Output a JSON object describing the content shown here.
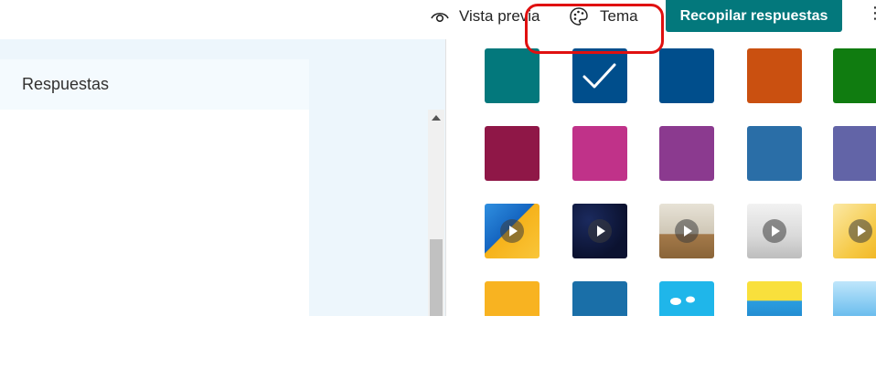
{
  "toolbar": {
    "preview_label": "Vista previa",
    "theme_label": "Tema",
    "collect_label": "Recopilar respuestas",
    "more_label": "⋮"
  },
  "left": {
    "responses_header": "Respuestas"
  },
  "theme": {
    "selected_index": 1,
    "rows": [
      [
        {
          "color": "#03787c"
        },
        {
          "color": "#004e8c",
          "selected": true
        },
        {
          "color": "#004e8c"
        },
        {
          "color": "#ca5010"
        },
        {
          "color": "#107c10"
        }
      ],
      [
        {
          "color": "#8f1747"
        },
        {
          "color": "#c03289"
        },
        {
          "color": "#8b3a8f"
        },
        {
          "color": "#2a6ea7"
        },
        {
          "color": "#6264a7"
        }
      ]
    ],
    "video_themes": [
      "blue-geometric-video",
      "dark-confetti-video",
      "living-room-video",
      "office-interior-video",
      "yellow-shapes-video"
    ],
    "image_themes": [
      "yellow-illustration",
      "blue-illustration",
      "sky-clouds-illustration",
      "yellow-sky-illustration",
      "city-illustration"
    ]
  },
  "colors": {
    "accent": "#03787c",
    "highlight": "#e01010",
    "background": "#edf6fc"
  }
}
